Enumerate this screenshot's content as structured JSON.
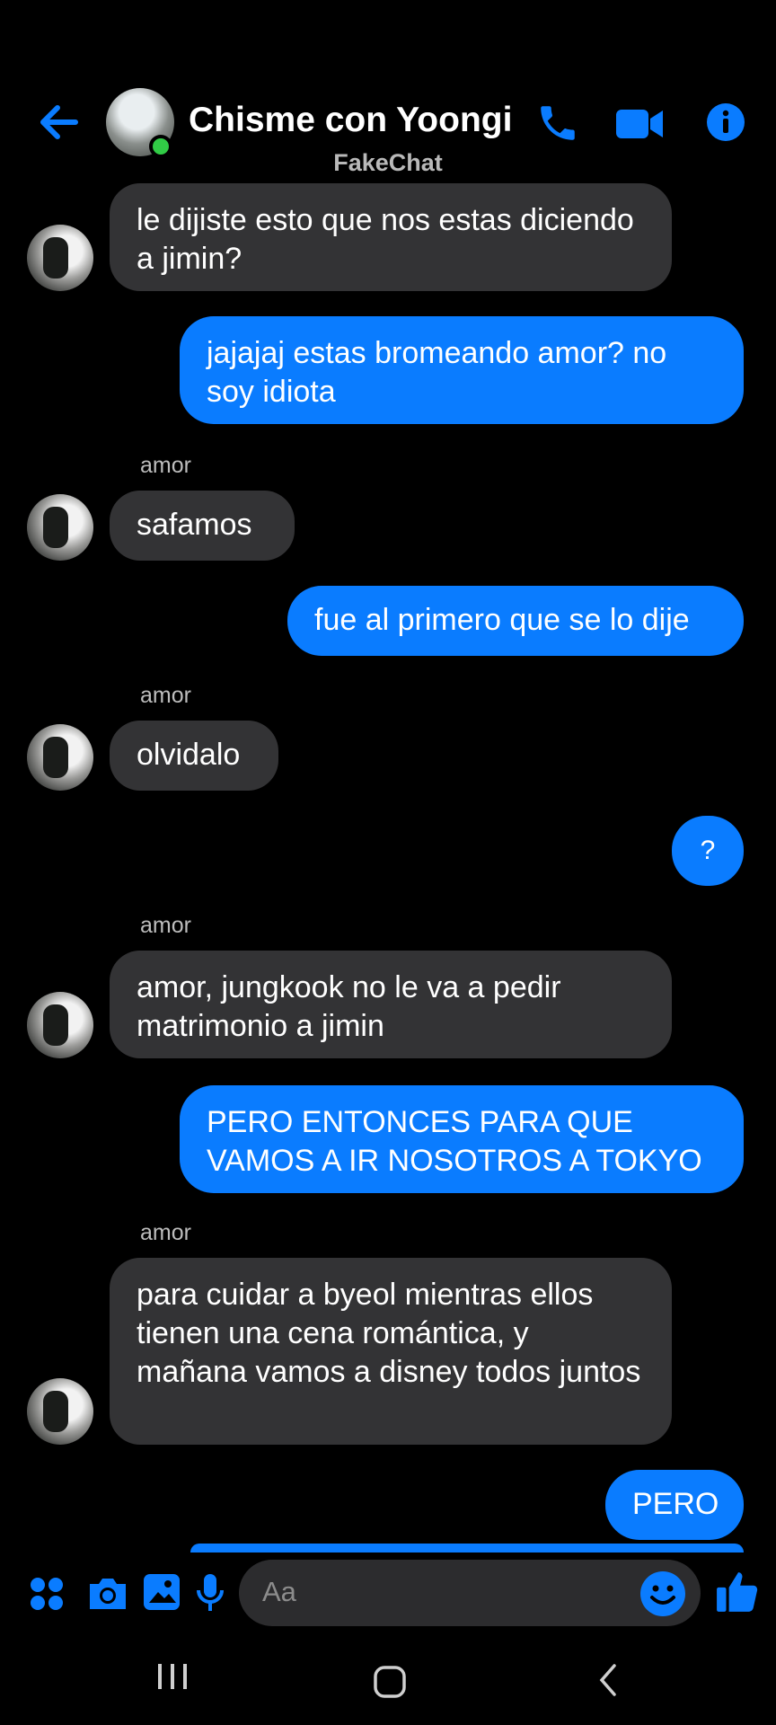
{
  "header": {
    "title": "Chisme con Yoongi",
    "subtitle": "FakeChat",
    "accent": "#0a7cff",
    "online_color": "#31cc46"
  },
  "messages": [
    {
      "dir": "in",
      "text": "le dijiste esto que nos estas diciendo a jimin?"
    },
    {
      "dir": "out",
      "text": "jajajaj estas bromeando amor? no soy idiota"
    },
    {
      "dir": "in",
      "sender": "amor",
      "text": "safamos"
    },
    {
      "dir": "out",
      "text": "fue al primero que se lo dije"
    },
    {
      "dir": "in",
      "sender": "amor",
      "text": "olvidalo"
    },
    {
      "dir": "out",
      "text": "?"
    },
    {
      "dir": "in",
      "sender": "amor",
      "text": "amor, jungkook no le va a pedir matrimonio a jimin"
    },
    {
      "dir": "out",
      "text": "PERO ENTONCES PARA QUE VAMOS A IR NOSOTROS A TOKYO"
    },
    {
      "dir": "in",
      "sender": "amor",
      "text": "para cuidar a byeol mientras ellos tienen una cena romántica, y mañana vamos a disney todos juntos"
    },
    {
      "dir": "out",
      "text": "PERO"
    }
  ],
  "composer": {
    "placeholder": "Aa",
    "icons": [
      "apps-icon",
      "camera-icon",
      "gallery-icon",
      "microphone-icon",
      "emoji-icon",
      "thumbs-up-icon"
    ]
  },
  "navbar": {
    "icons": [
      "recent-apps-icon",
      "home-icon",
      "back-icon"
    ]
  }
}
